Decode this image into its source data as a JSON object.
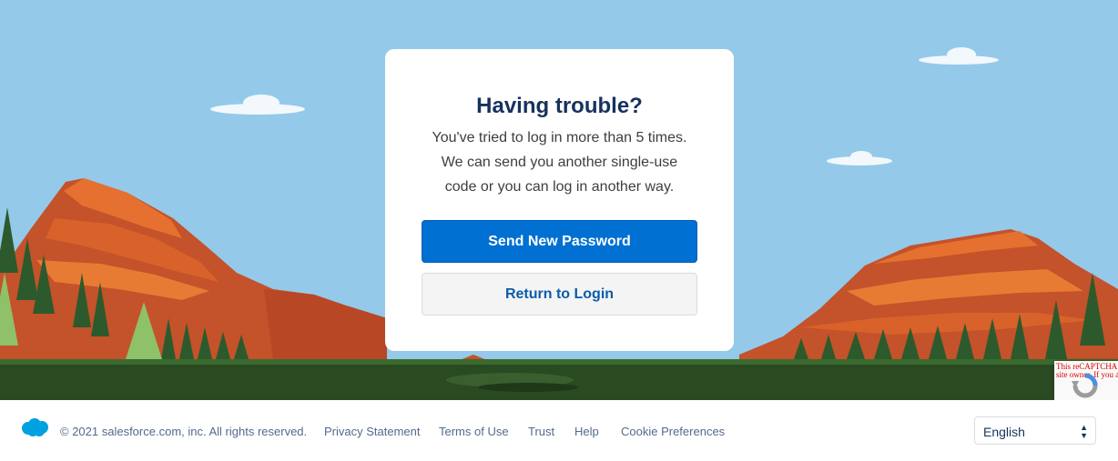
{
  "card": {
    "title": "Having trouble?",
    "message_lines": [
      "You've tried to log in more than 5 times.",
      "We can send you another single-use",
      "code or you can log in another way."
    ],
    "primary_button": "Send New Password",
    "secondary_button": "Return to Login"
  },
  "footer": {
    "copyright": "© 2021 salesforce.com, inc. All rights reserved.",
    "links": [
      "Privacy Statement",
      "Terms of Use",
      "Trust",
      "Help",
      "Cookie Preferences"
    ],
    "language": "English"
  },
  "recaptcha": {
    "line1": "This reCAPTCHA",
    "line2": "site owner. If you a"
  },
  "colors": {
    "sky": "#94c9ea",
    "primary": "#0070d2",
    "grass": "#2a4a22"
  },
  "icons": [
    "salesforce-cloud-logo",
    "recaptcha-logo",
    "select-arrow-icon"
  ]
}
